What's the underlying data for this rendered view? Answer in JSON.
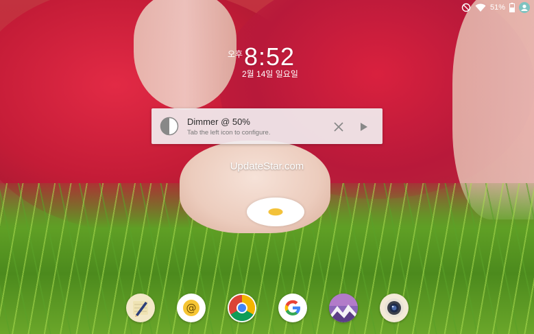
{
  "status_bar": {
    "battery_percent": "51%",
    "icons": [
      "no-disturb-icon",
      "wifi-icon",
      "battery-icon",
      "user-avatar-icon"
    ]
  },
  "clock": {
    "ampm": "오후",
    "time": "8:52",
    "date": "2월 14일 일요일"
  },
  "notification": {
    "title": "Dimmer @ 50%",
    "subtitle": "Tab the left icon to configure.",
    "icons": [
      "half-circle-icon",
      "close-icon",
      "play-icon"
    ]
  },
  "watermark": "UpdateStar.com",
  "dock": {
    "apps": [
      "pencil-app-icon",
      "email-app-icon",
      "chrome-app-icon",
      "google-app-icon",
      "gallery-app-icon",
      "camera-app-icon"
    ]
  }
}
